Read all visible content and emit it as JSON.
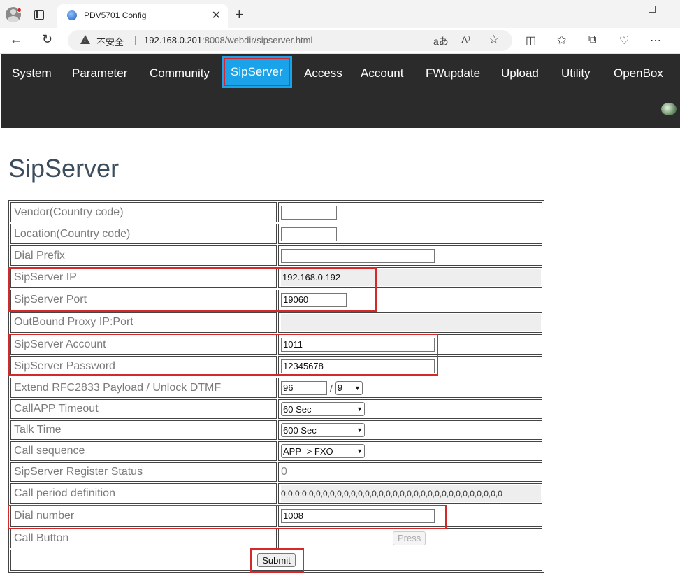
{
  "browser": {
    "tab_title": "PDV5701 Config",
    "insecure_label": "不安全",
    "url_host": "192.168.0.201",
    "url_rest": ":8008/webdir/sipserver.html"
  },
  "nav": {
    "items": [
      "System",
      "Parameter",
      "Community",
      "SipServer",
      "Access",
      "Account",
      "FWupdate",
      "Upload",
      "Utility",
      "OpenBox"
    ],
    "active": "SipServer",
    "active_color": "#1aa3e8"
  },
  "page": {
    "title": "SipServer"
  },
  "form": {
    "vendor_label": "Vendor(Country code)",
    "vendor_value": "",
    "location_label": "Location(Country code)",
    "location_value": "",
    "dial_prefix_label": "Dial Prefix",
    "dial_prefix_value": "",
    "sip_ip_label": "SipServer IP",
    "sip_ip_value": "192.168.0.192",
    "sip_port_label": "SipServer Port",
    "sip_port_value": "19060",
    "proxy_label": "OutBound Proxy IP:Port",
    "proxy_value": "",
    "account_label": "SipServer Account",
    "account_value": "1011",
    "password_label": "SipServer Password",
    "password_value": "12345678",
    "rfc_label": "Extend RFC2833 Payload / Unlock DTMF",
    "rfc_payload_value": "96",
    "rfc_separator": "/",
    "unlock_dtmf_value": "9",
    "callapp_label": "CallAPP Timeout",
    "callapp_value": "60 Sec",
    "talk_label": "Talk Time",
    "talk_value": "600 Sec",
    "sequence_label": "Call sequence",
    "sequence_value": "APP -> FXO",
    "reg_status_label": "SipServer Register Status",
    "reg_status_value": "0",
    "period_label": "Call period definition",
    "period_value": "0,0,0,0,0,0,0,0,0,0,0,0,0,0,0,0,0,0,0,0,0,0,0,0,0,0,0,0,0,0,0,0",
    "dial_number_label": "Dial number",
    "dial_number_value": "1008",
    "call_button_label": "Call Button",
    "press_label": "Press",
    "submit_label": "Submit"
  },
  "annotation_color": "#d22a2a"
}
